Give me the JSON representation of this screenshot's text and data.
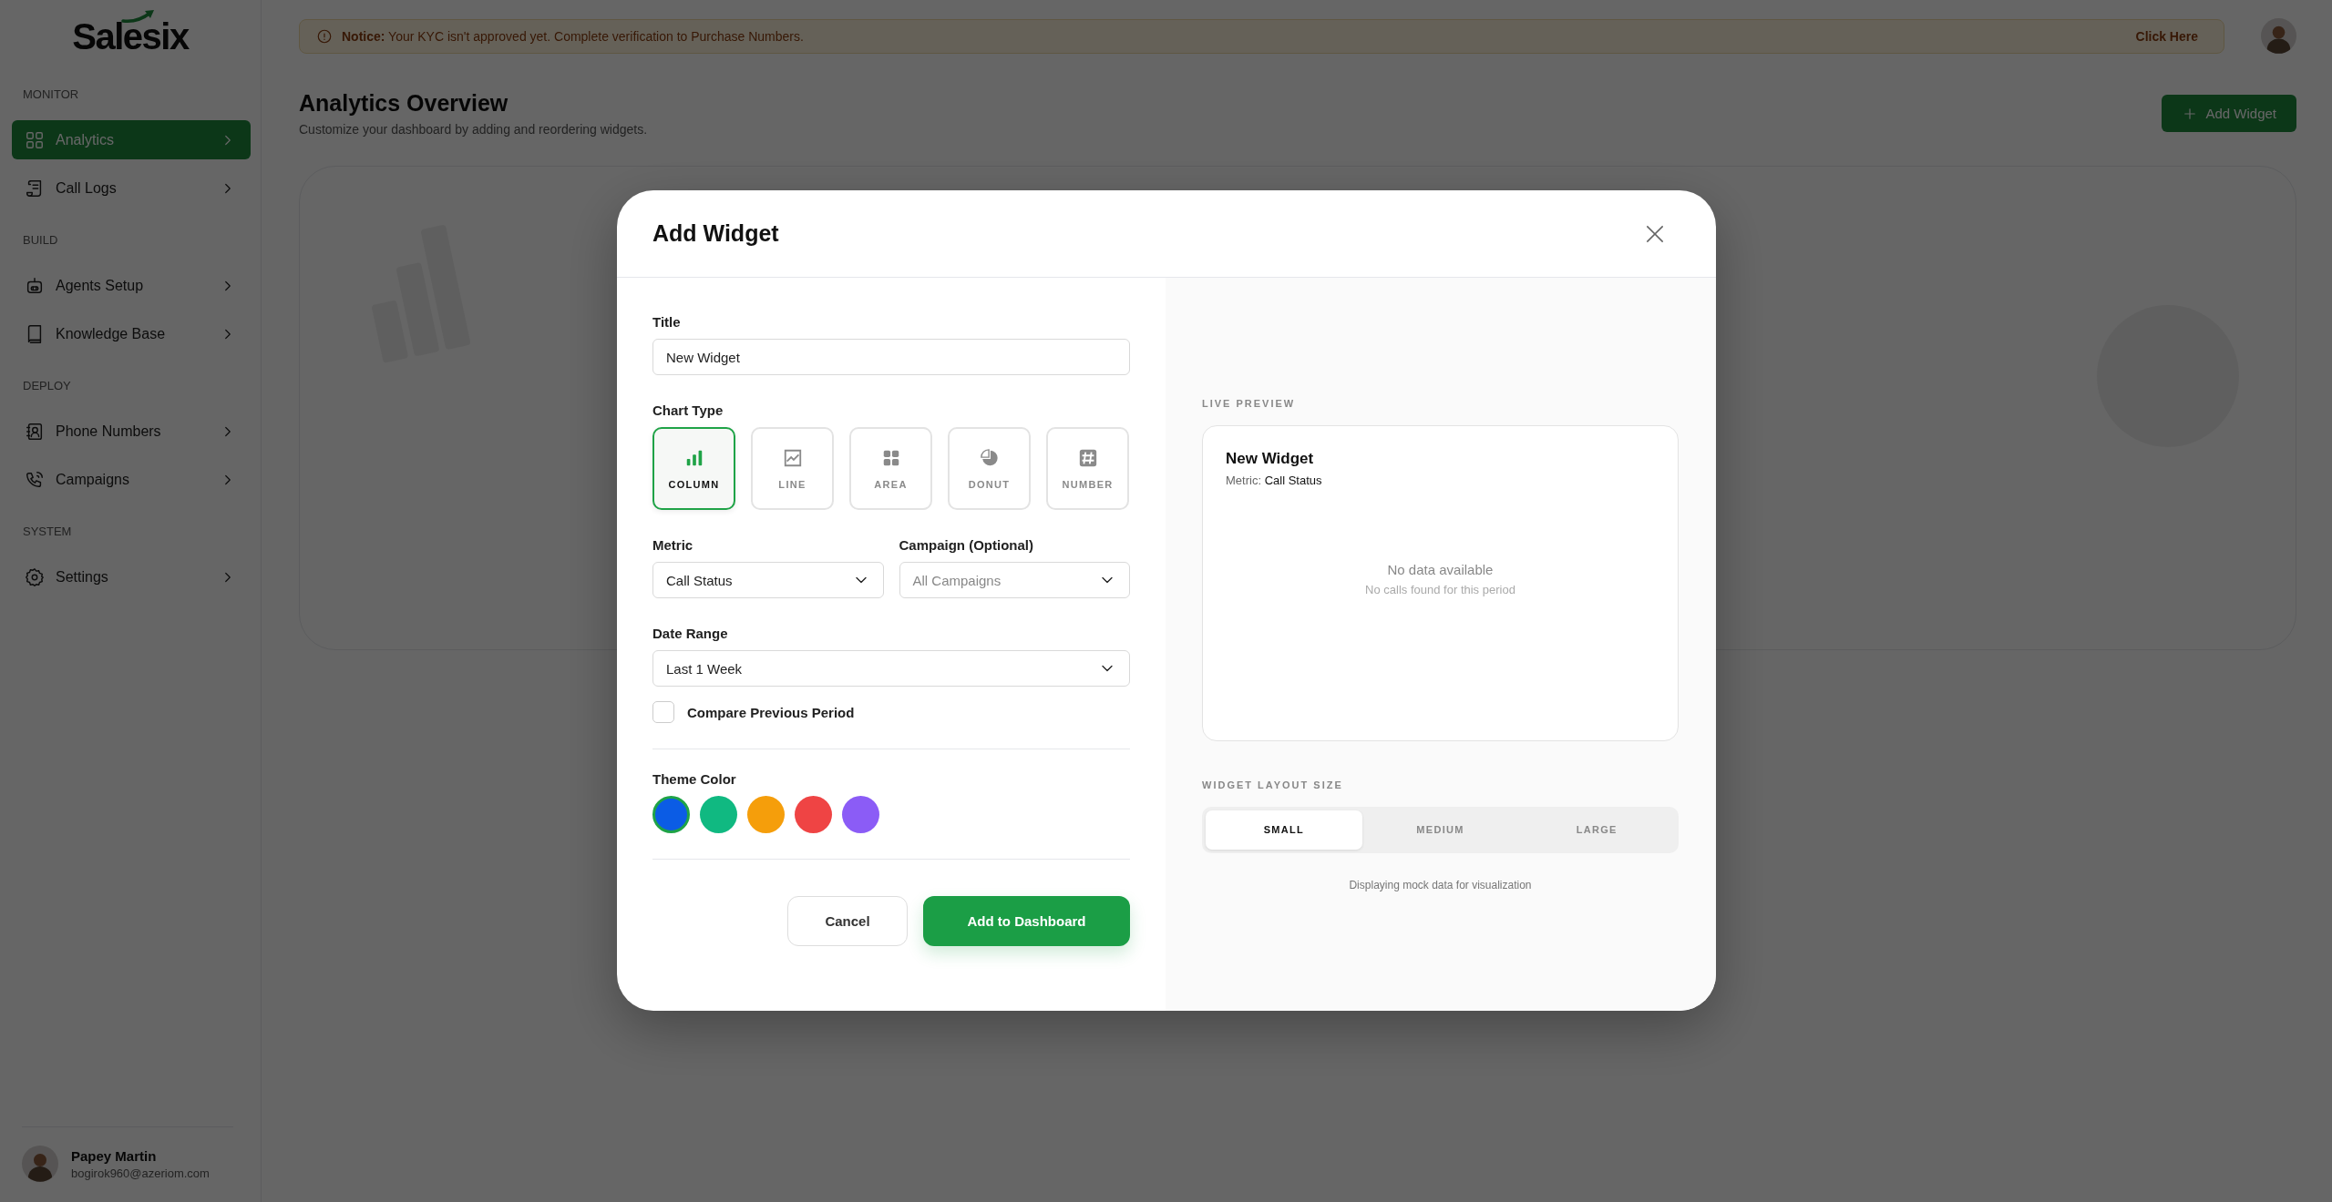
{
  "sidebar": {
    "logo": "Salesix",
    "sections": [
      {
        "title": "MONITOR",
        "items": [
          {
            "label": "Analytics",
            "selected": true
          },
          {
            "label": "Call Logs",
            "selected": false
          }
        ]
      },
      {
        "title": "BUILD",
        "items": [
          {
            "label": "Agents Setup",
            "selected": false
          },
          {
            "label": "Knowledge Base",
            "selected": false
          }
        ]
      },
      {
        "title": "DEPLOY",
        "items": [
          {
            "label": "Phone Numbers",
            "selected": false
          },
          {
            "label": "Campaigns",
            "selected": false
          }
        ]
      },
      {
        "title": "SYSTEM",
        "items": [
          {
            "label": "Settings",
            "selected": false
          }
        ]
      }
    ],
    "user": {
      "name": "Papey Martin",
      "email": "bogirok960@azeriom.com"
    }
  },
  "notice": {
    "message": "**Notice:**  Your KYC isn't approved yet. Complete verification to Purchase Numbers.",
    "link": "Click Here"
  },
  "page": {
    "title": "Analytics Overview",
    "subtitle": "Customize your dashboard by adding and reordering widgets.",
    "add_button": "Add Widget"
  },
  "modal": {
    "title": "Add Widget",
    "title_field": {
      "label": "Title",
      "value": "New Widget"
    },
    "chart_type": {
      "label": "Chart Type",
      "options": [
        {
          "label": "COLUMN",
          "selected": true
        },
        {
          "label": "LINE",
          "selected": false
        },
        {
          "label": "AREA",
          "selected": false
        },
        {
          "label": "DONUT",
          "selected": false
        },
        {
          "label": "NUMBER",
          "selected": false
        }
      ]
    },
    "metric": {
      "label": "Metric",
      "value": "Call Status"
    },
    "campaign": {
      "label": "Campaign (Optional)",
      "placeholder": "All Campaigns"
    },
    "date_range": {
      "label": "Date Range",
      "value": "Last 1 Week"
    },
    "compare": {
      "label": "Compare Previous Period",
      "checked": false
    },
    "theme_color": {
      "label": "Theme Color",
      "options": [
        {
          "color": "#0b5ce5",
          "selected": true
        },
        {
          "color": "#10b981",
          "selected": false
        },
        {
          "color": "#f59e0b",
          "selected": false
        },
        {
          "color": "#ef4444",
          "selected": false
        },
        {
          "color": "#8b5cf6",
          "selected": false
        }
      ]
    },
    "buttons": {
      "cancel": "Cancel",
      "submit": "Add to Dashboard"
    },
    "preview": {
      "label": "LIVE PREVIEW",
      "title": "New Widget",
      "metric_label": "Metric:",
      "metric_value": "Call Status",
      "empty_title": "No data available",
      "empty_subtitle": "No calls found for this period"
    },
    "layout_size": {
      "label": "WIDGET LAYOUT SIZE",
      "options": [
        {
          "label": "SMALL",
          "selected": true
        },
        {
          "label": "MEDIUM",
          "selected": false
        },
        {
          "label": "LARGE",
          "selected": false
        }
      ]
    },
    "footnote": "Displaying mock data for visualization"
  }
}
